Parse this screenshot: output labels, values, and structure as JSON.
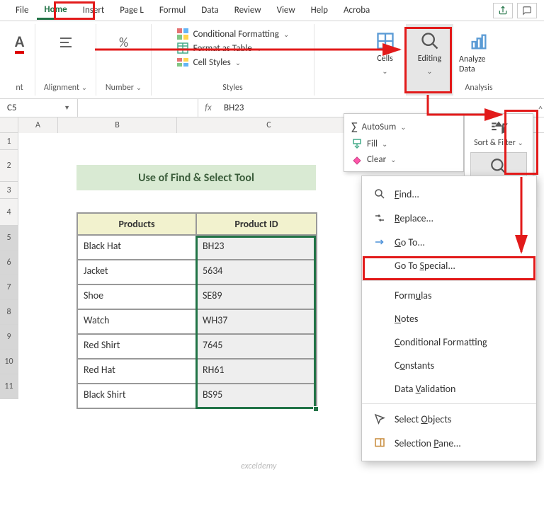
{
  "tabs": {
    "file": "File",
    "home": "Home",
    "insert": "Insert",
    "pagel": "Page L",
    "formul": "Formul",
    "data": "Data",
    "review": "Review",
    "view": "View",
    "help": "Help",
    "acrobat": "Acroba"
  },
  "ribbon": {
    "font_group": "nt",
    "alignment": "Alignment",
    "number": "Number",
    "cond_fmt": "Conditional Formatting",
    "fmt_table": "Format as Table",
    "cell_styles": "Cell Styles",
    "styles": "Styles",
    "cells": "Cells",
    "editing": "Editing",
    "analyze": "Analyze Data",
    "analysis": "Analysis"
  },
  "editing_dd": {
    "autosum": "AutoSum",
    "fill": "Fill",
    "clear": "Clear",
    "sortfilter": "Sort & Filter",
    "findselect": "Find & Select"
  },
  "fs_menu": {
    "find": "Find...",
    "replace": "Replace...",
    "goto": "Go To...",
    "gotospecial": "Go To Special...",
    "formulas": "Formulas",
    "notes": "Notes",
    "condfmt": "Conditional Formatting",
    "constants": "Constants",
    "datavalidation": "Data Validation",
    "selobjects": "Select Objects",
    "selpane": "Selection Pane..."
  },
  "namebox": "C5",
  "formula": "BH23",
  "col_headers": [
    "A",
    "B",
    "C"
  ],
  "row_headers": [
    "1",
    "2",
    "3",
    "4",
    "5",
    "6",
    "7",
    "8",
    "9",
    "10",
    "11"
  ],
  "title": "Use of Find & Select Tool",
  "thead": {
    "products": "Products",
    "pid": "Product ID"
  },
  "rows": [
    {
      "p": "Black Hat",
      "id": "BH23"
    },
    {
      "p": "Jacket",
      "id": "5634"
    },
    {
      "p": "Shoe",
      "id": "SE89"
    },
    {
      "p": "Watch",
      "id": "WH37"
    },
    {
      "p": "Red Shirt",
      "id": "7645"
    },
    {
      "p": "Red Hat",
      "id": "RH61"
    },
    {
      "p": "Black Shirt",
      "id": "BS95"
    }
  ],
  "watermark": "exceldemy"
}
